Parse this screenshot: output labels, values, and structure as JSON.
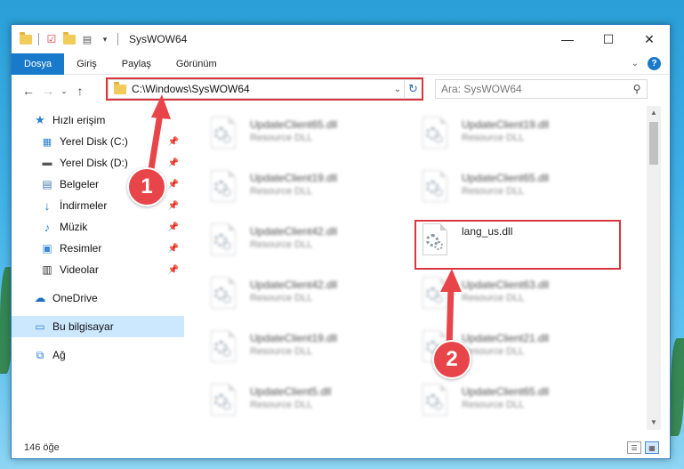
{
  "window": {
    "title": "SysWOW64",
    "controls": {
      "minimize": "—",
      "maximize": "☐",
      "close": "✕"
    }
  },
  "ribbon": {
    "tabs": [
      "Dosya",
      "Giriş",
      "Paylaş",
      "Görünüm"
    ]
  },
  "address": {
    "path": "C:\\Windows\\SysWOW64",
    "search_placeholder": "Ara: SysWOW64"
  },
  "navigation": {
    "quick_access": "Hızlı erişim",
    "pinned": [
      {
        "label": "Yerel Disk (C:)",
        "icon": "drive-icon"
      },
      {
        "label": "Yerel Disk (D:)",
        "icon": "drive-icon"
      },
      {
        "label": "Belgeler",
        "icon": "documents-icon"
      },
      {
        "label": "İndirmeler",
        "icon": "downloads-icon"
      },
      {
        "label": "Müzik",
        "icon": "music-icon"
      },
      {
        "label": "Resimler",
        "icon": "pictures-icon"
      },
      {
        "label": "Videolar",
        "icon": "videos-icon"
      }
    ],
    "onedrive": "OneDrive",
    "this_pc": "Bu bilgisayar",
    "network": "Ağ"
  },
  "files": [
    {
      "name": "UpdateClient65.dll",
      "type": "Resource DLL",
      "blurred": true
    },
    {
      "name": "UpdateClient19.dll",
      "type": "Resource DLL",
      "blurred": true
    },
    {
      "name": "UpdateClient19.dll",
      "type": "Resource DLL",
      "blurred": true
    },
    {
      "name": "UpdateClient65.dll",
      "type": "Resource DLL",
      "blurred": true
    },
    {
      "name": "UpdateClient42.dll",
      "type": "Resource DLL",
      "blurred": true
    },
    {
      "name": "lang_us.dll",
      "type": "",
      "blurred": false
    },
    {
      "name": "UpdateClient42.dll",
      "type": "Resource DLL",
      "blurred": true
    },
    {
      "name": "UpdateClient63.dll",
      "type": "Resource DLL",
      "blurred": true
    },
    {
      "name": "UpdateClient19.dll",
      "type": "Resource DLL",
      "blurred": true
    },
    {
      "name": "UpdateClient21.dll",
      "type": "Resource DLL",
      "blurred": true
    },
    {
      "name": "UpdateClient5.dll",
      "type": "Resource DLL",
      "blurred": true
    },
    {
      "name": "UpdateClient65.dll",
      "type": "Resource DLL",
      "blurred": true
    }
  ],
  "status": {
    "item_count": "146 öğe"
  },
  "annotations": {
    "step1": "1",
    "step2": "2",
    "color": "#e8454a"
  }
}
